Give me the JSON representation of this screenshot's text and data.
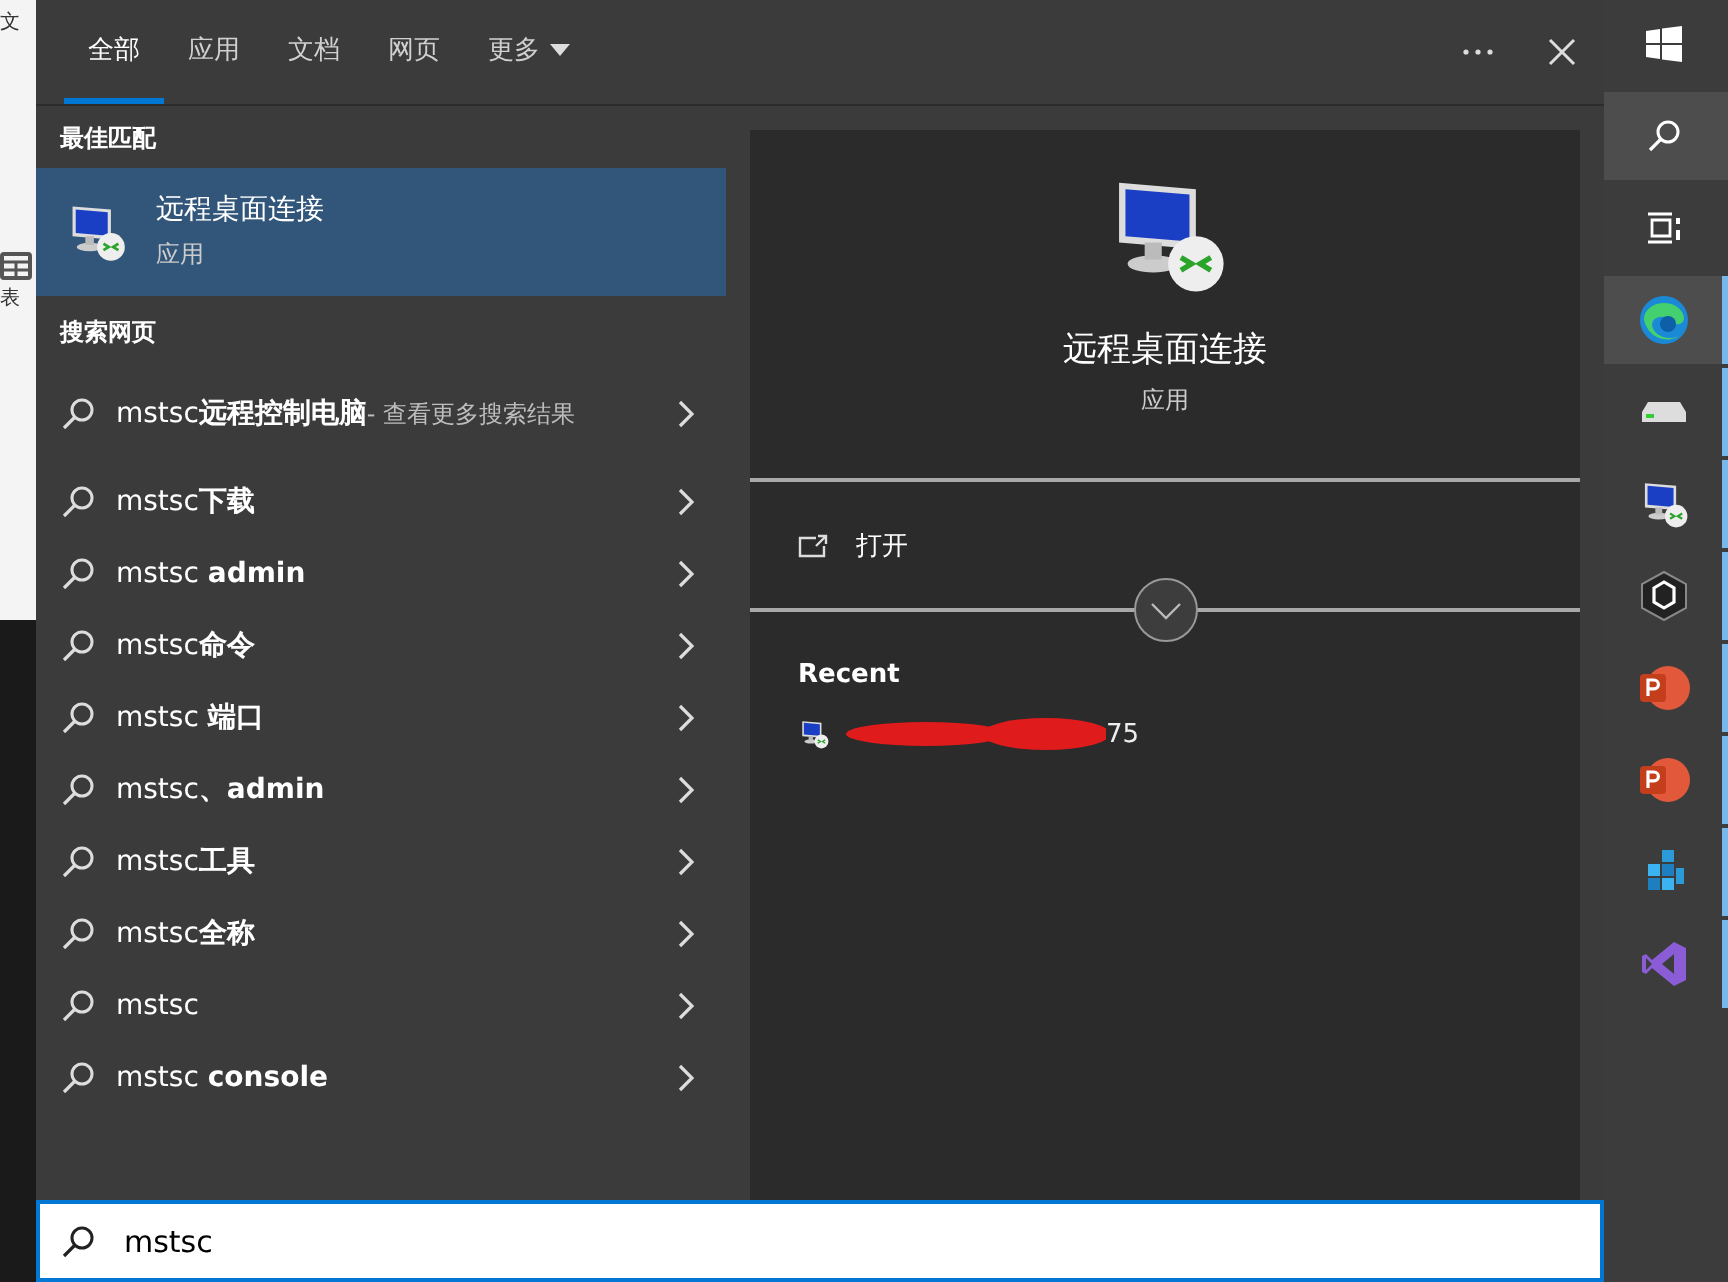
{
  "background_app": {
    "top_label": "文",
    "bottom_label": "表"
  },
  "tabs": [
    {
      "label": "全部",
      "selected": true
    },
    {
      "label": "应用",
      "selected": false
    },
    {
      "label": "文档",
      "selected": false
    },
    {
      "label": "网页",
      "selected": false
    },
    {
      "label": "更多",
      "selected": false,
      "dropdown": true
    }
  ],
  "best_match": {
    "heading": "最佳匹配",
    "title": "远程桌面连接",
    "subtitle": "应用",
    "selected": true
  },
  "web_search": {
    "heading": "搜索网页",
    "items": [
      {
        "label": "mstsc**远程控制电脑**",
        "suffix": " - 查看更多搜索结果"
      },
      {
        "label": "mstsc**下载**"
      },
      {
        "label": "mstsc **admin**"
      },
      {
        "label": "mstsc**命令**"
      },
      {
        "label": "mstsc **端口**"
      },
      {
        "label": "mstsc**、admin**"
      },
      {
        "label": "mstsc**工具**"
      },
      {
        "label": "mstsc**全称**"
      },
      {
        "label": "mstsc"
      },
      {
        "label": "mstsc **console**"
      }
    ]
  },
  "preview": {
    "title": "远程桌面连接",
    "subtitle": "应用",
    "action": "打开",
    "recent_heading": "Recent",
    "recent_items": [
      {
        "label_end": "75"
      }
    ]
  },
  "search_box": {
    "value": "mstsc"
  },
  "taskbar": [
    {
      "kind": "start",
      "running": false,
      "selected": false
    },
    {
      "kind": "search",
      "running": false,
      "selected": true
    },
    {
      "kind": "taskview",
      "running": false,
      "selected": false
    },
    {
      "kind": "edge",
      "running": true,
      "selected": true
    },
    {
      "kind": "drive",
      "running": true,
      "selected": false
    },
    {
      "kind": "rdp",
      "running": true,
      "selected": false
    },
    {
      "kind": "cube",
      "running": true,
      "selected": false
    },
    {
      "kind": "ppt",
      "running": true,
      "selected": false
    },
    {
      "kind": "ppt",
      "running": true,
      "selected": false
    },
    {
      "kind": "blocks",
      "running": true,
      "selected": false
    },
    {
      "kind": "vs",
      "running": true,
      "selected": false
    }
  ]
}
